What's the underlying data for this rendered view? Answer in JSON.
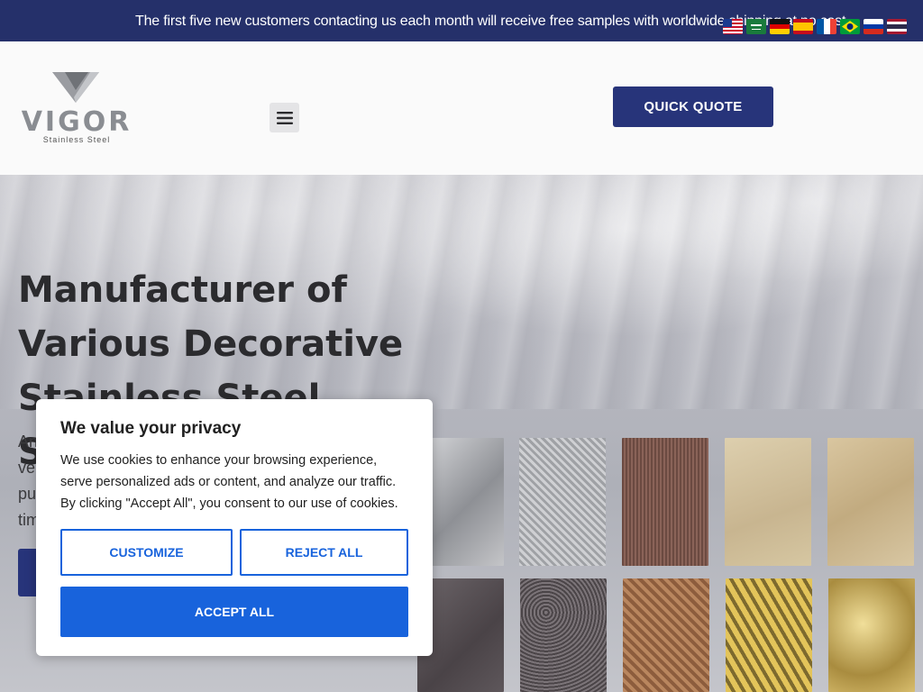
{
  "announcement": {
    "text": "The first five new customers contacting us each month will receive free samples with worldwide shipping at no cost."
  },
  "languages": [
    {
      "name": "us-flag-icon"
    },
    {
      "name": "saudi-arabia-flag-icon"
    },
    {
      "name": "germany-flag-icon"
    },
    {
      "name": "spain-flag-icon"
    },
    {
      "name": "france-flag-icon"
    },
    {
      "name": "brazil-flag-icon"
    },
    {
      "name": "russia-flag-icon"
    },
    {
      "name": "thailand-flag-icon"
    }
  ],
  "header": {
    "logo_text": "VIGOR",
    "logo_subtext": "Stainless Steel",
    "menu_icon": "hamburger-menu-icon",
    "quote_label": "QUICK QUOTE"
  },
  "hero": {
    "title": "Manufacturer of Various Decorative Stainless Steel Sheets",
    "description_visible_start": "An\nve\npu\ntim"
  },
  "cookie": {
    "title": "We value your privacy",
    "text": "We use cookies to enhance your browsing experience, serve personalized ads or content, and analyze our traffic. By clicking \"Accept All\", you consent to our use of cookies.",
    "customize_label": "CUSTOMIZE",
    "reject_label": "REJECT ALL",
    "accept_label": "ACCEPT ALL"
  },
  "colors": {
    "topbar": "#25306a",
    "brand_button": "#27347a",
    "cookie_accent": "#1863dc"
  }
}
